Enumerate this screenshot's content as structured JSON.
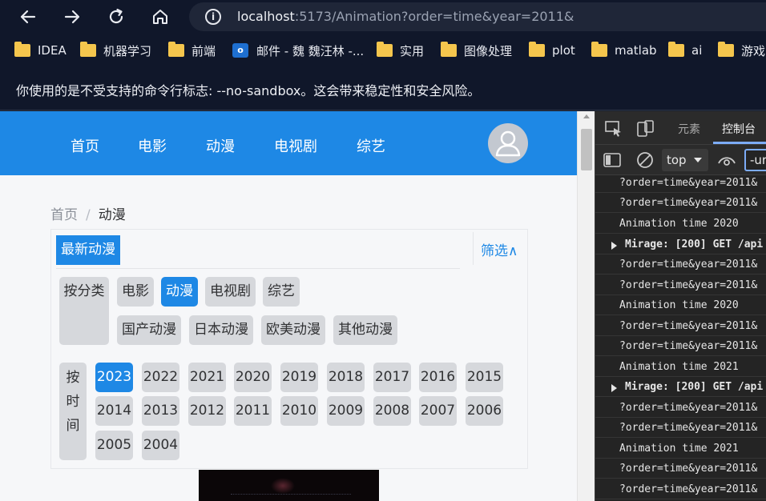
{
  "browser": {
    "url_host": "localhost",
    "url_rest": ":5173/Animation?order=time&year=2011&",
    "bookmarks": [
      {
        "label": "IDEA",
        "icon": "folder-icon"
      },
      {
        "label": "机器学习",
        "icon": "folder-icon"
      },
      {
        "label": "前端",
        "icon": "folder-icon"
      },
      {
        "label": "邮件 - 魏 魏汪林 -...",
        "icon": "outlook-icon"
      },
      {
        "label": "实用",
        "icon": "folder-icon"
      },
      {
        "label": "图像处理",
        "icon": "folder-icon"
      },
      {
        "label": "plot",
        "icon": "folder-icon"
      },
      {
        "label": "matlab",
        "icon": "folder-icon"
      },
      {
        "label": "ai",
        "icon": "folder-icon"
      },
      {
        "label": "游戏",
        "icon": "folder-icon"
      }
    ],
    "warning": "你使用的是不受支持的命令行标志: --no-sandbox。这会带来稳定性和安全风险。"
  },
  "site": {
    "nav": [
      "首页",
      "电影",
      "动漫",
      "电视剧",
      "综艺"
    ],
    "breadcrumb": {
      "home": "首页",
      "separator": "/",
      "current": "动漫"
    },
    "latest_label": "最新动漫",
    "filter_toggle": "筛选∧",
    "category_label": "按分类",
    "categories": [
      {
        "label": "电影",
        "active": false
      },
      {
        "label": "动漫",
        "active": true
      },
      {
        "label": "电视剧",
        "active": false
      },
      {
        "label": "综艺",
        "active": false
      }
    ],
    "subcategories": [
      "国产动漫",
      "日本动漫",
      "欧美动漫",
      "其他动漫"
    ],
    "time_label_chars": [
      "按",
      "时",
      "间"
    ],
    "years": [
      {
        "label": "2023",
        "active": true
      },
      {
        "label": "2022",
        "active": false
      },
      {
        "label": "2021",
        "active": false
      },
      {
        "label": "2020",
        "active": false
      },
      {
        "label": "2019",
        "active": false
      },
      {
        "label": "2018",
        "active": false
      },
      {
        "label": "2017",
        "active": false
      },
      {
        "label": "2016",
        "active": false
      },
      {
        "label": "2015",
        "active": false
      },
      {
        "label": "2014",
        "active": false
      },
      {
        "label": "2013",
        "active": false
      },
      {
        "label": "2012",
        "active": false
      },
      {
        "label": "2011",
        "active": false
      },
      {
        "label": "2010",
        "active": false
      },
      {
        "label": "2009",
        "active": false
      },
      {
        "label": "2008",
        "active": false
      },
      {
        "label": "2007",
        "active": false
      },
      {
        "label": "2006",
        "active": false
      },
      {
        "label": "2005",
        "active": false
      },
      {
        "label": "2004",
        "active": false
      }
    ]
  },
  "devtools": {
    "tabs": {
      "elements": "元素",
      "console": "控制台"
    },
    "context": "top",
    "filter_value": "-url",
    "logs": [
      {
        "text": "?order=time&year=2011&",
        "group": false
      },
      {
        "text": "?order=time&year=2011&",
        "group": false
      },
      {
        "text": "Animation  time  2020",
        "group": false
      },
      {
        "text": "Mirage: [200] GET /api",
        "group": true
      },
      {
        "text": "?order=time&year=2011&",
        "group": false
      },
      {
        "text": "?order=time&year=2011&",
        "group": false
      },
      {
        "text": "Animation  time  2020",
        "group": false
      },
      {
        "text": "?order=time&year=2011&",
        "group": false
      },
      {
        "text": "?order=time&year=2011&",
        "group": false
      },
      {
        "text": "Animation  time  2021",
        "group": false
      },
      {
        "text": "Mirage: [200] GET /api",
        "group": true
      },
      {
        "text": "?order=time&year=2011&",
        "group": false
      },
      {
        "text": "?order=time&year=2011&",
        "group": false
      },
      {
        "text": "Animation  time  2021",
        "group": false
      },
      {
        "text": "?order=time&year=2011&",
        "group": false
      },
      {
        "text": "?order=time&year=2011&",
        "group": false
      }
    ]
  },
  "colors": {
    "brand": "#1e88e5",
    "chip": "#d6d8dc",
    "devtools_accent": "#7cacf8"
  }
}
